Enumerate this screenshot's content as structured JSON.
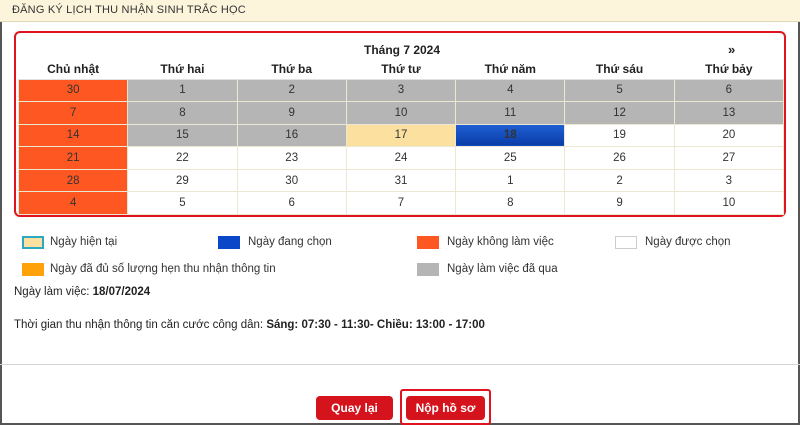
{
  "header": {
    "title": "ĐĂNG KÝ LỊCH THU NHẬN SINH TRẮC HỌC"
  },
  "calendar": {
    "month_label": "Tháng 7 2024",
    "next_label": "»",
    "weekdays": [
      "Chủ nhật",
      "Thứ hai",
      "Thứ ba",
      "Thứ tư",
      "Thứ năm",
      "Thứ sáu",
      "Thứ bảy"
    ],
    "weeks": [
      [
        {
          "d": "30",
          "s": "off"
        },
        {
          "d": "1",
          "s": "past"
        },
        {
          "d": "2",
          "s": "past"
        },
        {
          "d": "3",
          "s": "past"
        },
        {
          "d": "4",
          "s": "past"
        },
        {
          "d": "5",
          "s": "past"
        },
        {
          "d": "6",
          "s": "past"
        }
      ],
      [
        {
          "d": "7",
          "s": "off"
        },
        {
          "d": "8",
          "s": "past"
        },
        {
          "d": "9",
          "s": "past"
        },
        {
          "d": "10",
          "s": "past"
        },
        {
          "d": "11",
          "s": "past"
        },
        {
          "d": "12",
          "s": "past"
        },
        {
          "d": "13",
          "s": "past"
        }
      ],
      [
        {
          "d": "14",
          "s": "off"
        },
        {
          "d": "15",
          "s": "past"
        },
        {
          "d": "16",
          "s": "past"
        },
        {
          "d": "17",
          "s": "today"
        },
        {
          "d": "18",
          "s": "selected"
        },
        {
          "d": "19",
          "s": "normal"
        },
        {
          "d": "20",
          "s": "normal"
        }
      ],
      [
        {
          "d": "21",
          "s": "off"
        },
        {
          "d": "22",
          "s": "normal"
        },
        {
          "d": "23",
          "s": "normal"
        },
        {
          "d": "24",
          "s": "normal"
        },
        {
          "d": "25",
          "s": "normal"
        },
        {
          "d": "26",
          "s": "normal"
        },
        {
          "d": "27",
          "s": "normal"
        }
      ],
      [
        {
          "d": "28",
          "s": "off"
        },
        {
          "d": "29",
          "s": "normal"
        },
        {
          "d": "30",
          "s": "normal"
        },
        {
          "d": "31",
          "s": "normal"
        },
        {
          "d": "1",
          "s": "other"
        },
        {
          "d": "2",
          "s": "other"
        },
        {
          "d": "3",
          "s": "other"
        }
      ],
      [
        {
          "d": "4",
          "s": "off"
        },
        {
          "d": "5",
          "s": "other"
        },
        {
          "d": "6",
          "s": "other"
        },
        {
          "d": "7",
          "s": "other"
        },
        {
          "d": "8",
          "s": "other"
        },
        {
          "d": "9",
          "s": "other"
        },
        {
          "d": "10",
          "s": "other"
        }
      ]
    ]
  },
  "legend": {
    "today": {
      "label": "Ngày hiện tại",
      "color": "#fbe0a0",
      "border": "#2ba8c2"
    },
    "selecting": {
      "label": "Ngày đang chọn",
      "color": "#0a46c8"
    },
    "off": {
      "label": "Ngày không làm việc",
      "color": "#ff5722"
    },
    "chosen": {
      "label": "Ngày được chọn",
      "color": "#ffffff"
    },
    "full": {
      "label": "Ngày đã đủ số lượng hẹn thu nhận thông tin",
      "color": "#ffa20a"
    },
    "past": {
      "label": "Ngày làm việc đã qua",
      "color": "#b5b5b5"
    }
  },
  "info": {
    "workday_label": "Ngày làm việc:",
    "workday_value": "18/07/2024",
    "time_label": "Thời gian thu nhận thông tin căn cước công dân:",
    "time_value": "Sáng: 07:30 - 11:30- Chiều: 13:00 - 17:00"
  },
  "buttons": {
    "back": "Quay lại",
    "submit": "Nộp hồ sơ"
  },
  "colors": {
    "accent": "#d4131c",
    "highlight_border": "#e0141e"
  }
}
